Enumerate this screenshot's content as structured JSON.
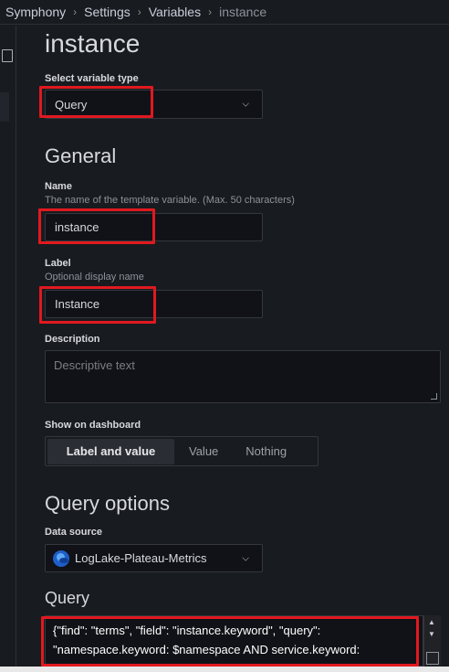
{
  "breadcrumb": [
    "Symphony",
    "Settings",
    "Variables",
    "instance"
  ],
  "page_title": "instance",
  "variable_type": {
    "label": "Select variable type",
    "value": "Query"
  },
  "general": {
    "heading": "General",
    "name_label": "Name",
    "name_desc": "The name of the template variable. (Max. 50 characters)",
    "name_value": "instance",
    "label_label": "Label",
    "label_desc": "Optional display name",
    "label_value": "Instance",
    "description_label": "Description",
    "description_placeholder": "Descriptive text",
    "show_label": "Show on dashboard",
    "show_options": [
      "Label and value",
      "Value",
      "Nothing"
    ],
    "show_selected": "Label and value"
  },
  "query_options": {
    "heading": "Query options",
    "datasource_label": "Data source",
    "datasource_value": "LogLake-Plateau-Metrics",
    "query_heading": "Query",
    "query_text": "{\"find\": \"terms\", \"field\": \"instance.keyword\", \"query\": \"namespace.keyword: $namespace AND service.keyword:"
  },
  "colors": {
    "highlight": "#e0191f",
    "background": "#181b1f"
  },
  "icons": [
    "chevron-right-icon",
    "chevron-down-icon",
    "datasource-logo-icon",
    "resize-grip-icon"
  ]
}
